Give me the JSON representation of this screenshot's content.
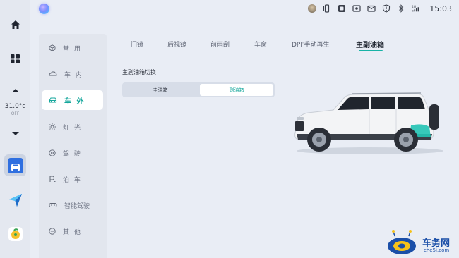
{
  "status_bar": {
    "time": "15:03",
    "icons": [
      "user-avatar-icon",
      "vibration-icon",
      "media-icon",
      "record-icon",
      "mail-icon",
      "shield-icon",
      "bluetooth-icon",
      "signal-4g-icon"
    ],
    "signal_label": "4G"
  },
  "dock": {
    "temperature": "31.0°c",
    "ac_mode": "OFF",
    "icons": [
      "home-icon",
      "apps-grid-icon",
      "temp-up-icon",
      "temp-down-icon",
      "vehicle-settings-app-icon",
      "navigation-app-icon",
      "music-app-icon"
    ]
  },
  "nav": {
    "items": [
      {
        "label": "常 用",
        "icon": "cube-icon"
      },
      {
        "label": "车 内",
        "icon": "car-interior-icon"
      },
      {
        "label": "车 外",
        "icon": "car-exterior-icon",
        "active": true
      },
      {
        "label": "灯 光",
        "icon": "light-icon"
      },
      {
        "label": "驾 驶",
        "icon": "steering-icon"
      },
      {
        "label": "泊 车",
        "icon": "parking-icon"
      },
      {
        "label": "智能驾驶",
        "icon": "smart-drive-icon"
      },
      {
        "label": "其 他",
        "icon": "other-icon"
      }
    ]
  },
  "tabs": [
    {
      "label": "门锁"
    },
    {
      "label": "后视镜"
    },
    {
      "label": "前雨刮"
    },
    {
      "label": "车窗"
    },
    {
      "label": "DPF手动再生"
    },
    {
      "label": "主副油箱",
      "active": true
    }
  ],
  "fuel_tank": {
    "title": "主副油箱切换",
    "options": [
      "主油箱",
      "副油箱"
    ],
    "selected": "副油箱"
  },
  "colors": {
    "accent": "#16a79c",
    "background": "#e9edf5",
    "panel": "#e2e6ee"
  },
  "watermark": {
    "brand": "车务网",
    "url": "che5i.com"
  }
}
